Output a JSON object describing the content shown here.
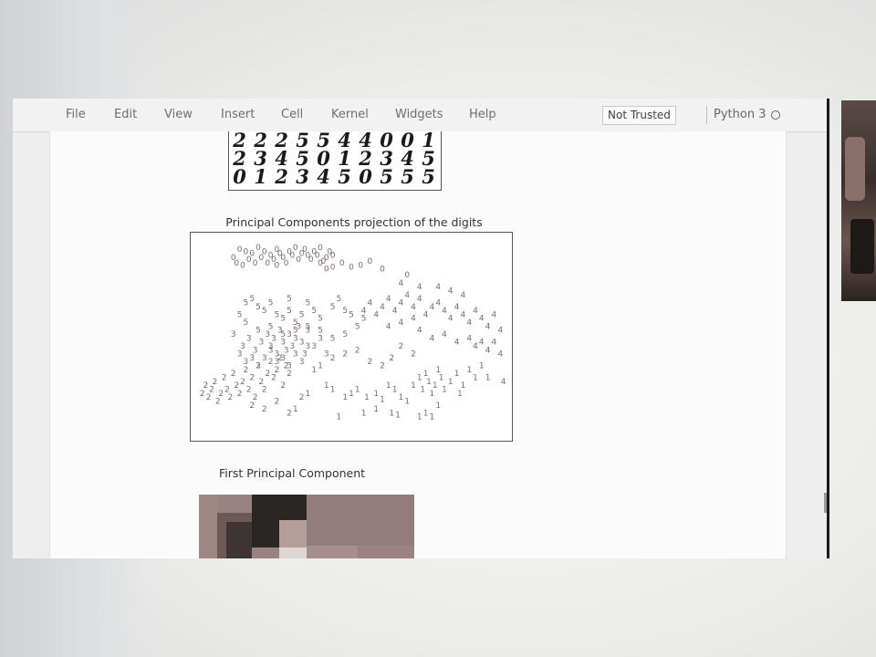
{
  "menu": {
    "items": [
      {
        "label": "File"
      },
      {
        "label": "Edit"
      },
      {
        "label": "View"
      },
      {
        "label": "Insert"
      },
      {
        "label": "Cell"
      },
      {
        "label": "Kernel"
      },
      {
        "label": "Widgets"
      },
      {
        "label": "Help"
      }
    ],
    "trust_button": "Not Trusted",
    "kernel_name": "Python 3"
  },
  "digits_grid": {
    "rows": [
      [
        "2",
        "2",
        "2",
        "5",
        "5",
        "4",
        "4",
        "0",
        "0",
        "1"
      ],
      [
        "2",
        "3",
        "4",
        "5",
        "0",
        "1",
        "2",
        "3",
        "4",
        "5"
      ],
      [
        "0",
        "1",
        "2",
        "3",
        "4",
        "5",
        "0",
        "5",
        "5",
        "5"
      ]
    ]
  },
  "pca_plot": {
    "title": "Principal Components projection of the digits"
  },
  "first_component": {
    "title": "First Principal Component"
  },
  "colors": {
    "point_color": "#7d6a68",
    "digit_ink": "#1a1a1a"
  },
  "chart_data": {
    "type": "scatter",
    "title": "Principal Components projection of the digits",
    "xlabel": "",
    "ylabel": "",
    "xlim": [
      0,
      100
    ],
    "ylim": [
      0,
      100
    ],
    "grid": false,
    "series": [
      {
        "name": "0",
        "points": [
          [
            14,
            93
          ],
          [
            16,
            92
          ],
          [
            18,
            91
          ],
          [
            20,
            94
          ],
          [
            22,
            92
          ],
          [
            24,
            90
          ],
          [
            25,
            88
          ],
          [
            26,
            93
          ],
          [
            27,
            91
          ],
          [
            28,
            89
          ],
          [
            30,
            92
          ],
          [
            31,
            90
          ],
          [
            32,
            94
          ],
          [
            33,
            88
          ],
          [
            34,
            91
          ],
          [
            35,
            93
          ],
          [
            36,
            90
          ],
          [
            37,
            88
          ],
          [
            38,
            92
          ],
          [
            39,
            90
          ],
          [
            40,
            94
          ],
          [
            41,
            87
          ],
          [
            42,
            89
          ],
          [
            43,
            92
          ],
          [
            44,
            90
          ],
          [
            12,
            89
          ],
          [
            13,
            86
          ],
          [
            15,
            85
          ],
          [
            17,
            88
          ],
          [
            19,
            86
          ],
          [
            21,
            89
          ],
          [
            23,
            86
          ],
          [
            26,
            85
          ],
          [
            29,
            86
          ],
          [
            40,
            86
          ],
          [
            42,
            83
          ],
          [
            44,
            84
          ],
          [
            47,
            86
          ],
          [
            50,
            84
          ],
          [
            53,
            85
          ],
          [
            56,
            87
          ],
          [
            60,
            83
          ],
          [
            68,
            80
          ]
        ]
      },
      {
        "name": "1",
        "points": [
          [
            38,
            32
          ],
          [
            40,
            34
          ],
          [
            42,
            24
          ],
          [
            44,
            22
          ],
          [
            48,
            18
          ],
          [
            50,
            20
          ],
          [
            52,
            22
          ],
          [
            55,
            18
          ],
          [
            58,
            20
          ],
          [
            60,
            17
          ],
          [
            62,
            24
          ],
          [
            64,
            22
          ],
          [
            66,
            18
          ],
          [
            68,
            16
          ],
          [
            70,
            24
          ],
          [
            72,
            28
          ],
          [
            73,
            22
          ],
          [
            74,
            30
          ],
          [
            75,
            26
          ],
          [
            76,
            20
          ],
          [
            77,
            24
          ],
          [
            78,
            32
          ],
          [
            79,
            28
          ],
          [
            80,
            22
          ],
          [
            82,
            26
          ],
          [
            84,
            30
          ],
          [
            85,
            20
          ],
          [
            86,
            24
          ],
          [
            88,
            32
          ],
          [
            90,
            28
          ],
          [
            92,
            34
          ],
          [
            94,
            28
          ],
          [
            36,
            20
          ],
          [
            32,
            12
          ],
          [
            46,
            8
          ],
          [
            54,
            10
          ],
          [
            58,
            12
          ],
          [
            63,
            10
          ],
          [
            65,
            9
          ],
          [
            72,
            8
          ],
          [
            74,
            10
          ],
          [
            76,
            8
          ],
          [
            78,
            14
          ]
        ]
      },
      {
        "name": "2",
        "points": [
          [
            2,
            20
          ],
          [
            3,
            24
          ],
          [
            4,
            18
          ],
          [
            5,
            22
          ],
          [
            6,
            26
          ],
          [
            7,
            16
          ],
          [
            8,
            20
          ],
          [
            9,
            28
          ],
          [
            10,
            22
          ],
          [
            11,
            18
          ],
          [
            12,
            30
          ],
          [
            13,
            24
          ],
          [
            14,
            20
          ],
          [
            15,
            26
          ],
          [
            16,
            32
          ],
          [
            17,
            22
          ],
          [
            18,
            28
          ],
          [
            19,
            18
          ],
          [
            20,
            34
          ],
          [
            21,
            26
          ],
          [
            22,
            22
          ],
          [
            23,
            30
          ],
          [
            24,
            36
          ],
          [
            25,
            28
          ],
          [
            26,
            32
          ],
          [
            27,
            38
          ],
          [
            28,
            24
          ],
          [
            29,
            34
          ],
          [
            30,
            30
          ],
          [
            18,
            14
          ],
          [
            22,
            12
          ],
          [
            26,
            16
          ],
          [
            30,
            10
          ],
          [
            34,
            18
          ],
          [
            44,
            38
          ],
          [
            48,
            40
          ],
          [
            52,
            42
          ],
          [
            56,
            36
          ],
          [
            60,
            34
          ],
          [
            63,
            38
          ],
          [
            66,
            44
          ],
          [
            70,
            40
          ]
        ]
      },
      {
        "name": "3",
        "points": [
          [
            15,
            44
          ],
          [
            17,
            48
          ],
          [
            19,
            42
          ],
          [
            21,
            46
          ],
          [
            23,
            50
          ],
          [
            24,
            44
          ],
          [
            25,
            48
          ],
          [
            26,
            40
          ],
          [
            27,
            52
          ],
          [
            28,
            46
          ],
          [
            29,
            42
          ],
          [
            30,
            50
          ],
          [
            31,
            44
          ],
          [
            32,
            48
          ],
          [
            33,
            54
          ],
          [
            34,
            46
          ],
          [
            35,
            40
          ],
          [
            36,
            52
          ],
          [
            14,
            40
          ],
          [
            16,
            36
          ],
          [
            18,
            38
          ],
          [
            20,
            34
          ],
          [
            22,
            38
          ],
          [
            24,
            42
          ],
          [
            26,
            36
          ],
          [
            28,
            38
          ],
          [
            30,
            34
          ],
          [
            32,
            40
          ],
          [
            34,
            36
          ],
          [
            36,
            44
          ],
          [
            12,
            50
          ],
          [
            38,
            44
          ],
          [
            40,
            48
          ],
          [
            42,
            40
          ]
        ]
      },
      {
        "name": "4",
        "points": [
          [
            54,
            62
          ],
          [
            56,
            66
          ],
          [
            58,
            60
          ],
          [
            60,
            64
          ],
          [
            62,
            68
          ],
          [
            64,
            62
          ],
          [
            66,
            66
          ],
          [
            68,
            70
          ],
          [
            70,
            64
          ],
          [
            72,
            68
          ],
          [
            74,
            60
          ],
          [
            76,
            64
          ],
          [
            78,
            66
          ],
          [
            80,
            62
          ],
          [
            82,
            58
          ],
          [
            84,
            64
          ],
          [
            86,
            60
          ],
          [
            88,
            56
          ],
          [
            90,
            62
          ],
          [
            92,
            58
          ],
          [
            94,
            54
          ],
          [
            96,
            60
          ],
          [
            72,
            52
          ],
          [
            76,
            48
          ],
          [
            80,
            50
          ],
          [
            84,
            46
          ],
          [
            88,
            48
          ],
          [
            90,
            44
          ],
          [
            92,
            46
          ],
          [
            94,
            42
          ],
          [
            96,
            46
          ],
          [
            98,
            52
          ],
          [
            98,
            40
          ],
          [
            99,
            26
          ],
          [
            70,
            58
          ],
          [
            66,
            56
          ],
          [
            62,
            54
          ],
          [
            82,
            72
          ],
          [
            78,
            74
          ],
          [
            86,
            70
          ],
          [
            66,
            76
          ],
          [
            72,
            74
          ]
        ]
      },
      {
        "name": "5",
        "points": [
          [
            16,
            66
          ],
          [
            18,
            68
          ],
          [
            20,
            64
          ],
          [
            22,
            62
          ],
          [
            24,
            66
          ],
          [
            26,
            60
          ],
          [
            28,
            58
          ],
          [
            30,
            62
          ],
          [
            32,
            56
          ],
          [
            34,
            60
          ],
          [
            36,
            66
          ],
          [
            38,
            62
          ],
          [
            40,
            58
          ],
          [
            44,
            64
          ],
          [
            46,
            68
          ],
          [
            48,
            62
          ],
          [
            50,
            60
          ],
          [
            52,
            54
          ],
          [
            54,
            58
          ],
          [
            16,
            56
          ],
          [
            20,
            52
          ],
          [
            24,
            54
          ],
          [
            28,
            50
          ],
          [
            32,
            52
          ],
          [
            36,
            54
          ],
          [
            40,
            52
          ],
          [
            44,
            48
          ],
          [
            48,
            50
          ],
          [
            14,
            60
          ],
          [
            30,
            68
          ]
        ]
      }
    ]
  }
}
